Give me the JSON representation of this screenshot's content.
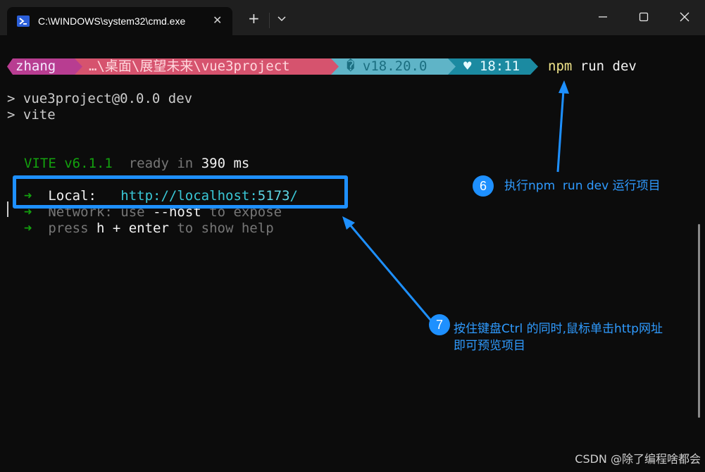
{
  "window": {
    "tab_title": "C:\\WINDOWS\\system32\\cmd.exe",
    "close_tab_glyph": "✕",
    "new_tab_glyph": "+",
    "icons": [
      "terminal-app-icon",
      "chevron-down-icon",
      "minimize-icon",
      "maximize-icon",
      "close-icon"
    ]
  },
  "prompt": {
    "user": "zhang",
    "path": "…\\桌面\\展望未来\\vue3project",
    "node": "� v18.20.0",
    "time": "♥ 18:11",
    "command_part1": "npm",
    "command_part2": " run dev"
  },
  "output": {
    "line1": "> vue3project@0.0.0 dev",
    "line2": "> vite",
    "vite_name": "VITE v6.1.1",
    "ready_text": "  ready in ",
    "ready_ms": "390",
    "ms_unit": " ms",
    "arrow": "➜",
    "local_label": "  Local:   ",
    "local_url_a": "http://localhost:",
    "local_url_port": "5173",
    "local_url_b": "/",
    "network_label": "  Network: ",
    "network_use": "use ",
    "network_flag": "--host",
    "network_rest": " to expose",
    "press": "  press ",
    "press_key": "h + enter",
    "press_rest": " to show help"
  },
  "annotations": {
    "badge6": "6",
    "note6": "执行npm  run dev 运行项目",
    "badge7": "7",
    "note7_line1": "按住键盘Ctrl 的同时,鼠标单击http网址",
    "note7_line2": "即可预览项目"
  },
  "watermark": "CSDN @除了编程啥都会",
  "colors": {
    "segment_user": "#b83d91",
    "segment_path": "#d6536e",
    "segment_node": "#5fb4c7",
    "segment_time": "#1b8aa1",
    "annotation_blue": "#1e90ff"
  }
}
